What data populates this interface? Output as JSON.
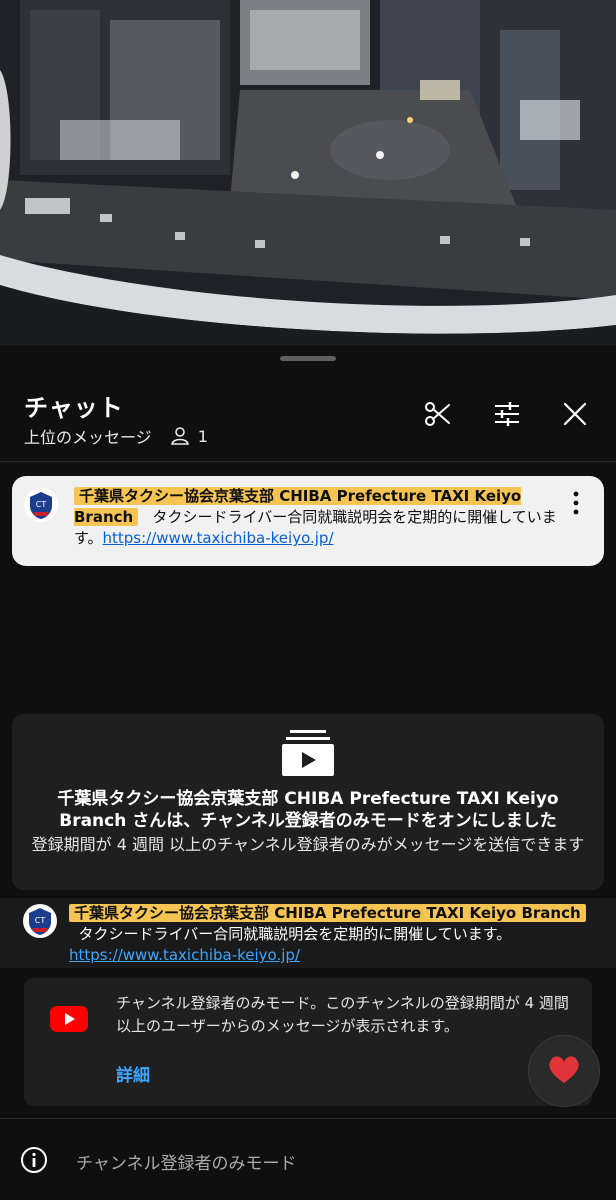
{
  "chat_header": {
    "title": "チャット",
    "subtitle": "上位のメッセージ",
    "viewer_count": "1"
  },
  "pinned_message": {
    "author": "千葉県タクシー協会京葉支部 CHIBA Prefecture TAXI Keiyo Branch",
    "text": "タクシードライバー合同就職説明会を定期的に開催しています。",
    "link": "https://www.taxichiba-keiyo.jp/"
  },
  "mode_notice": {
    "heading": "千葉県タクシー協会京葉支部 CHIBA Prefecture TAXI Keiyo Branch さんは、チャンネル登録者のみモードをオンにしました",
    "description": "登録期間が 4 週間 以上のチャンネル登録者のみがメッセージを送信できます"
  },
  "chat_message": {
    "author": "千葉県タクシー協会京葉支部 CHIBA Prefecture TAXI Keiyo Branch",
    "text": "タクシードライバー合同就職説明会を定期的に開催しています。",
    "link": "https://www.taxichiba-keiyo.jp/"
  },
  "info_card": {
    "text": "チャンネル登録者のみモード。このチャンネルの登録期間が 4 週間 以上のユーザーからのメッセージが表示されます。",
    "more_label": "詳細"
  },
  "bottom_bar": {
    "status": "チャンネル登録者のみモード"
  },
  "icons": {
    "close": "close-icon",
    "settings": "sliders-icon",
    "clip": "scissors-icon",
    "viewers": "person-icon",
    "menu": "kebab-icon",
    "info": "info-icon",
    "reaction": "heart-icon",
    "brand": "youtube-icon"
  },
  "colors": {
    "author_highlight": "#f6c453",
    "link": "#3ea6ff",
    "youtube_red": "#ff0000",
    "heart": "#e0333a"
  }
}
